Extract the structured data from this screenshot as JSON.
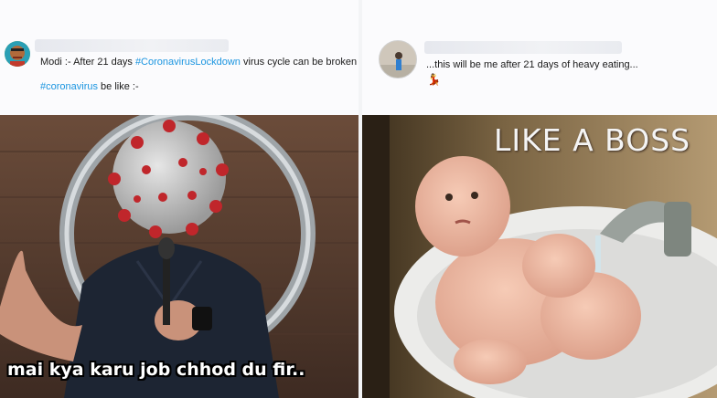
{
  "left_tweet": {
    "text_prefix": "Modi :- After 21 days ",
    "hashtag1": "#CoronavirusLockdown",
    "text_suffix": " virus cycle can be broken",
    "hashtag2": "#coronavirus",
    "line2_suffix": "  be like :-",
    "meme_caption": "mai kya karu job chhod du fir.."
  },
  "right_tweet": {
    "text": "...this will be me after 21 days of heavy eating...",
    "emoji": "💃",
    "meme_caption": "LIKE A BOSS"
  },
  "colors": {
    "hashtag": "#1b95e0",
    "caption_text": "#ffffff"
  }
}
